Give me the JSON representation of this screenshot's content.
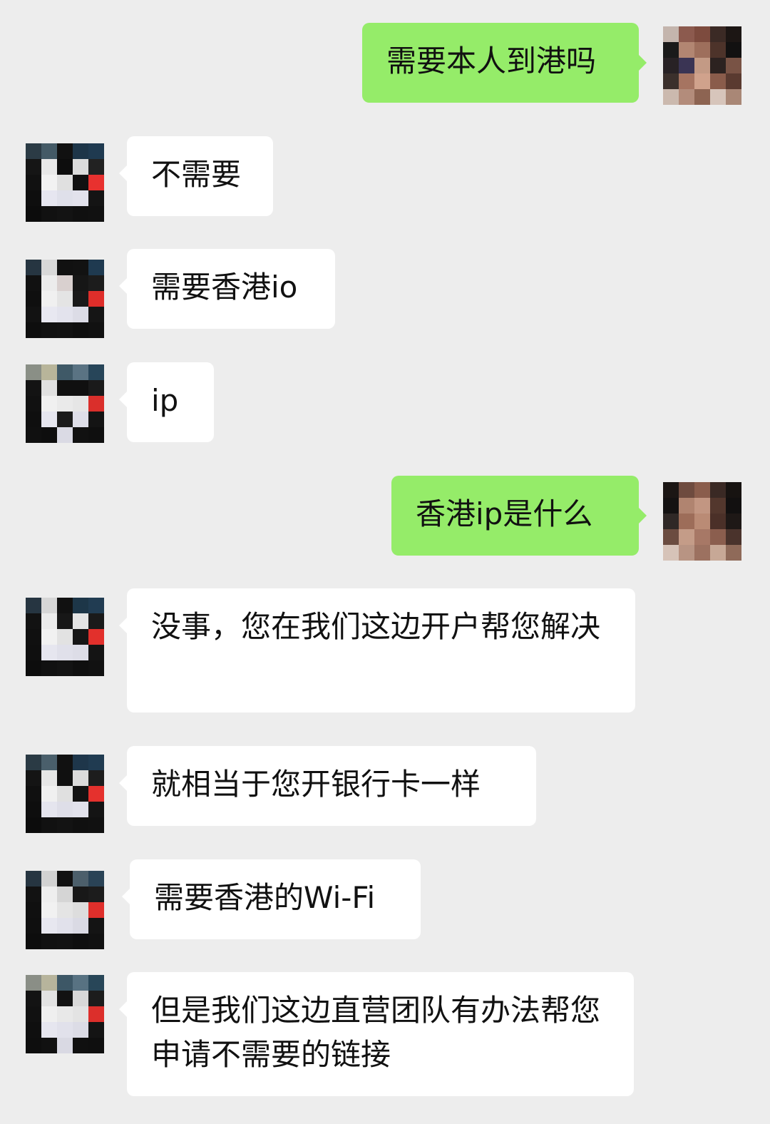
{
  "colors": {
    "background": "#ededed",
    "incoming_bubble": "#ffffff",
    "outgoing_bubble": "#95ec69",
    "text": "#111111"
  },
  "avatar_icons": {
    "self": "pixelated-self-avatar",
    "contact": "pixelated-contact-avatar"
  },
  "messages": [
    {
      "sender": "self",
      "text": "需要本人到港吗"
    },
    {
      "sender": "contact",
      "text": "不需要"
    },
    {
      "sender": "contact",
      "text": "需要香港io"
    },
    {
      "sender": "contact",
      "text": "ip"
    },
    {
      "sender": "self",
      "text": "香港ip是什么"
    },
    {
      "sender": "contact",
      "text": "没事，您在我们这边开户帮您解决"
    },
    {
      "sender": "contact",
      "text": "就相当于您开银行卡一样"
    },
    {
      "sender": "contact",
      "text": "需要香港的Wi-Fi"
    },
    {
      "sender": "contact",
      "text": "但是我们这边直营团队有办法帮您申请不需要的链接"
    }
  ]
}
